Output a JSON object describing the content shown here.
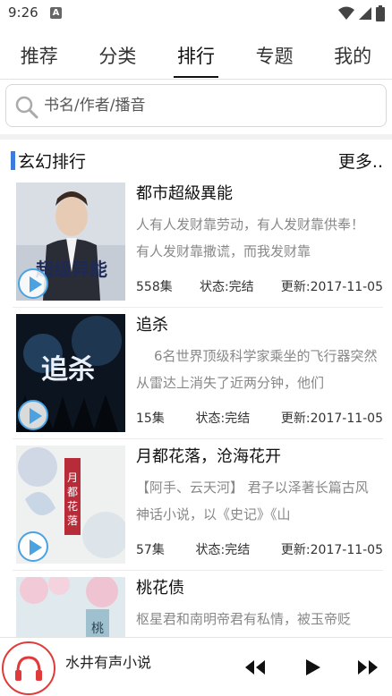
{
  "status_bar": {
    "time": "9:26",
    "app_icon": "A"
  },
  "tabs": [
    {
      "label": "推荐"
    },
    {
      "label": "分类"
    },
    {
      "label": "排行"
    },
    {
      "label": "专题"
    },
    {
      "label": "我的"
    }
  ],
  "search": {
    "placeholder": "书名/作者/播音"
  },
  "section": {
    "title": "玄幻排行",
    "more": "更多.."
  },
  "books": [
    {
      "title": "都市超級異能",
      "desc": "人有人发财靠劳动，有人发财靠供奉！ 有人发财靠撒谎，而我发财靠",
      "episodes": "558集",
      "status": "状态:完结",
      "updated": "更新:2017-11-05",
      "cover_text": "超级异能"
    },
    {
      "title": "追杀",
      "desc": "6名世界顶级科学家乘坐的飞行器突然从雷达上消失了近两分钟，他们",
      "episodes": "15集",
      "status": "状态:完结",
      "updated": "更新:2017-11-05",
      "cover_text": "追杀"
    },
    {
      "title": "月都花落，沧海花开",
      "desc": "【阿手、云天河】 君子以泽著长篇古风神话小说，以《史记》《山",
      "episodes": "57集",
      "status": "状态:完结",
      "updated": "更新:2017-11-05",
      "cover_text": "月都花落"
    },
    {
      "title": "桃花债",
      "desc": "枢星君和南明帝君有私情，被玉帝贬",
      "episodes": "",
      "status": "",
      "updated": "",
      "cover_text": "桃花"
    }
  ],
  "player": {
    "title": "水井有声小说"
  },
  "colors": {
    "accent_blue": "#3b7ddd",
    "play_blue": "#4aa3e0",
    "player_red": "#e03a3a"
  }
}
